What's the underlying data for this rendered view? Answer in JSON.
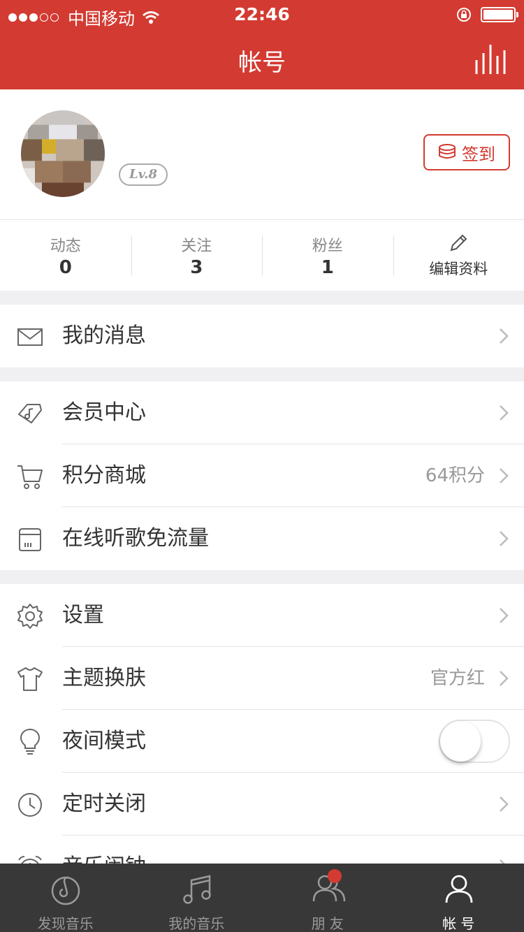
{
  "status_bar": {
    "carrier": "中国移动",
    "time": "22:46"
  },
  "header": {
    "title": "帐号"
  },
  "profile": {
    "level": "Lv.8",
    "signin_label": "签到"
  },
  "stats": [
    {
      "label": "动态",
      "value": "0"
    },
    {
      "label": "关注",
      "value": "3"
    },
    {
      "label": "粉丝",
      "value": "1"
    }
  ],
  "edit_profile": "编辑资料",
  "menu": {
    "messages": "我的消息",
    "vip": "会员中心",
    "mall": "积分商城",
    "mall_value": "64积分",
    "free_data": "在线听歌免流量",
    "settings": "设置",
    "theme": "主题换肤",
    "theme_value": "官方红",
    "night": "夜间模式",
    "night_on": false,
    "timer": "定时关闭",
    "alarm": "音乐闹钟"
  },
  "tabs": [
    {
      "label": "发现音乐",
      "active": false
    },
    {
      "label": "我的音乐",
      "active": false
    },
    {
      "label": "朋 友",
      "active": false,
      "badge": true
    },
    {
      "label": "帐 号",
      "active": true
    }
  ],
  "colors": {
    "brand": "#d33a31",
    "tabbar": "#383838"
  }
}
